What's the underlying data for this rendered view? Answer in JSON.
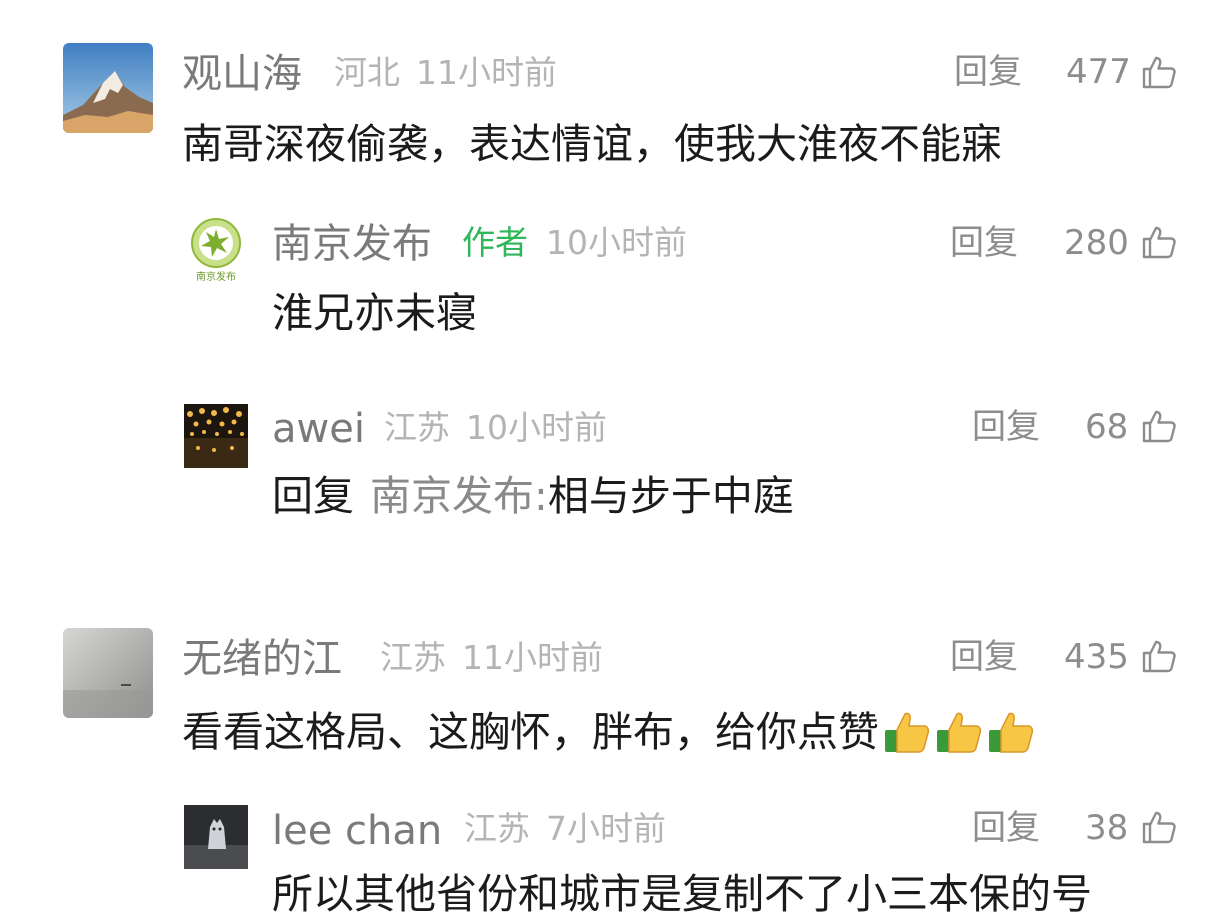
{
  "comments": [
    {
      "user": "观山海",
      "location": "河北",
      "time": "11小时前",
      "reply_label": "回复",
      "likes": "477",
      "text": "南哥深夜偷袭，表达情谊，使我大淮夜不能寐",
      "avatar_icon": "snowy-mountain-avatar"
    },
    {
      "user": "南京发布",
      "author_badge": "作者",
      "time": "10小时前",
      "reply_label": "回复",
      "likes": "280",
      "text": "淮兄亦未寝",
      "avatar_icon": "nanjing-fabu-logo-avatar",
      "avatar_caption": "南京发布"
    },
    {
      "user": "awei",
      "location": "江苏",
      "time": "10小时前",
      "reply_label": "回复",
      "likes": "68",
      "reply_prefix": "回复",
      "reply_target": "南京发布:",
      "text": "相与步于中庭",
      "avatar_icon": "lanterns-avatar"
    },
    {
      "user": "无绪的江",
      "location": "江苏",
      "time": "11小时前",
      "reply_label": "回复",
      "likes": "435",
      "text": "看看这格局、这胸怀，胖布，给你点赞",
      "emoji": [
        "thumbs-up-emoji",
        "thumbs-up-emoji",
        "thumbs-up-emoji"
      ],
      "avatar_icon": "foggy-river-avatar"
    },
    {
      "user": "lee chan",
      "location": "江苏",
      "time": "7小时前",
      "reply_label": "回复",
      "likes": "38",
      "text": "所以其他省份和城市是复制不了小三本保的号",
      "avatar_icon": "cat-figurine-avatar"
    }
  ],
  "colors": {
    "name": "#7a7a7a",
    "meta": "#b4b4b4",
    "author_badge": "#2fb55a",
    "body": "#1b1b1b",
    "action": "#8d8d8d",
    "background": "#ffffff"
  }
}
